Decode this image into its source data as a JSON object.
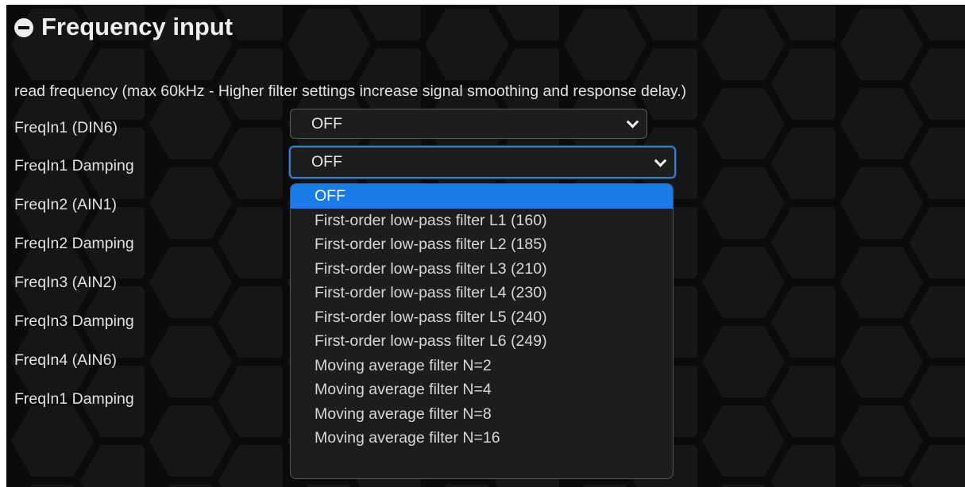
{
  "section": {
    "title": "Frequency input",
    "description": "read frequency (max 60kHz - Higher filter settings increase signal smoothing and response delay.)"
  },
  "rows": [
    {
      "label": "FreqIn1 (DIN6)",
      "value": "OFF"
    },
    {
      "label": "FreqIn1 Damping",
      "value": "OFF"
    },
    {
      "label": "FreqIn2 (AIN1)"
    },
    {
      "label": "FreqIn2 Damping"
    },
    {
      "label": "FreqIn3 (AIN2)"
    },
    {
      "label": "FreqIn3 Damping"
    },
    {
      "label": "FreqIn4 (AIN6)"
    },
    {
      "label": "FreqIn1 Damping"
    }
  ],
  "dropdown": {
    "selected_index": 0,
    "options": [
      "OFF",
      "First-order low-pass filter L1 (160)",
      "First-order low-pass filter L2 (185)",
      "First-order low-pass filter L3 (210)",
      "First-order low-pass filter L4 (230)",
      "First-order low-pass filter L5 (240)",
      "First-order low-pass filter L6 (249)",
      "Moving average filter N=2",
      "Moving average filter N=4",
      "Moving average filter N=8",
      "Moving average filter N=16"
    ]
  },
  "colors": {
    "background": "#0b0b0b",
    "hex_pattern": "#1a1a1a",
    "text": "#e2e2e2",
    "select_bg": "#1d1d1d",
    "focus_border": "#2a7fd6",
    "selected_option": "#1a7ce6"
  },
  "icons": {
    "section_toggle": "minus-circle-icon",
    "select_arrow": "chevron-down-icon"
  }
}
